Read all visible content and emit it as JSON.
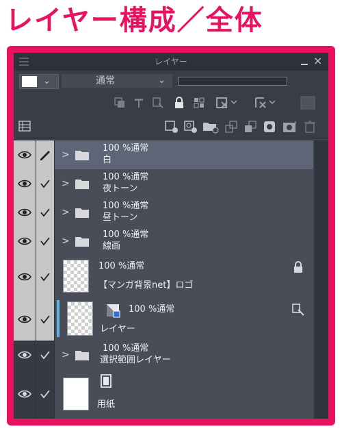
{
  "heading": "レイヤー構成／全体",
  "panel": {
    "title": "レイヤー",
    "blend_mode": "通常",
    "color_chevron": "⌄",
    "blend_chevron": "⌄"
  },
  "toolbar_icons": [
    "clip-to-lower-icon",
    "reference-layer-icon",
    "draft-layer-icon",
    "lock-icon",
    "lock-transparency-icon",
    "mask-enable-icon",
    "mask-disable-icon",
    "layer-color-icon"
  ],
  "layers": [
    {
      "name": "白",
      "opacity": "100 %通常",
      "type": "folder",
      "selected": true
    },
    {
      "name": "夜トーン",
      "opacity": "100 %通常",
      "type": "folder"
    },
    {
      "name": "昼トーン",
      "opacity": "100 %通常",
      "type": "folder"
    },
    {
      "name": "線画",
      "opacity": "100 %通常",
      "type": "folder"
    },
    {
      "name": "【マンガ背景net】ロゴ",
      "opacity": "100 %通常",
      "type": "raster",
      "locked": true
    },
    {
      "name": "レイヤー",
      "opacity": "100 %通常",
      "type": "raster",
      "draft": true,
      "active": true
    },
    {
      "name": "選択範囲レイヤー",
      "opacity": "100 %通常",
      "type": "folder"
    },
    {
      "name": "用紙",
      "opacity": "",
      "type": "paper"
    }
  ],
  "colors": {
    "accent": "#e8125e",
    "panel_bg": "#3d414c",
    "selected_row": "#5d6576",
    "active_marker": "#5fb7e6"
  }
}
